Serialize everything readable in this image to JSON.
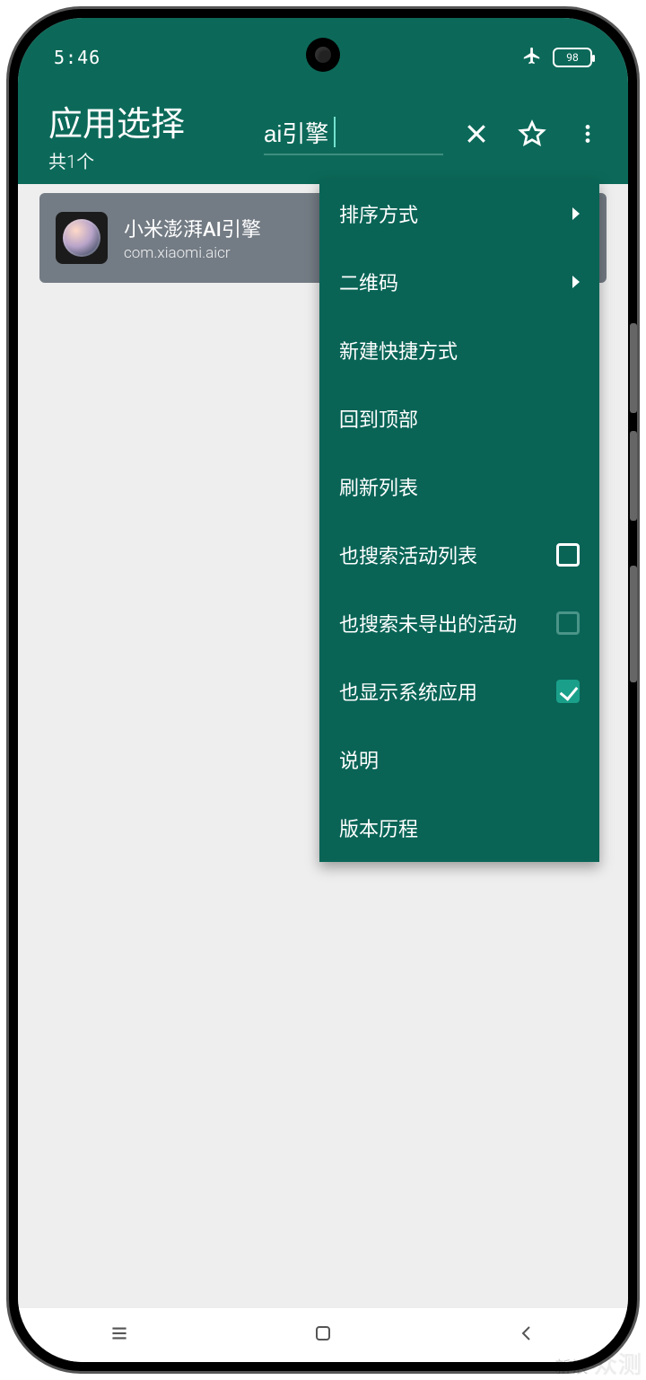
{
  "status": {
    "time": "5:46",
    "battery_pct": "98",
    "plane_mode": true
  },
  "header": {
    "title": "应用选择",
    "subtitle": "共1个",
    "search_value": "ai引擎"
  },
  "list": {
    "items": [
      {
        "name": "小米澎湃AI引擎",
        "package": "com.xiaomi.aicr"
      }
    ]
  },
  "menu": {
    "items": [
      {
        "label": "排序方式",
        "has_arrow": true
      },
      {
        "label": "二维码",
        "has_arrow": true
      },
      {
        "label": "新建快捷方式"
      },
      {
        "label": "回到顶部"
      },
      {
        "label": "刷新列表"
      },
      {
        "label": "也搜索活动列表",
        "checkbox": "unchecked"
      },
      {
        "label": "也搜索未导出的活动",
        "checkbox": "disabled"
      },
      {
        "label": "也显示系统应用",
        "checkbox": "checked"
      },
      {
        "label": "说明"
      },
      {
        "label": "版本历程"
      }
    ]
  },
  "watermark": {
    "brand_small": "新浪",
    "brand_big": "众测"
  }
}
